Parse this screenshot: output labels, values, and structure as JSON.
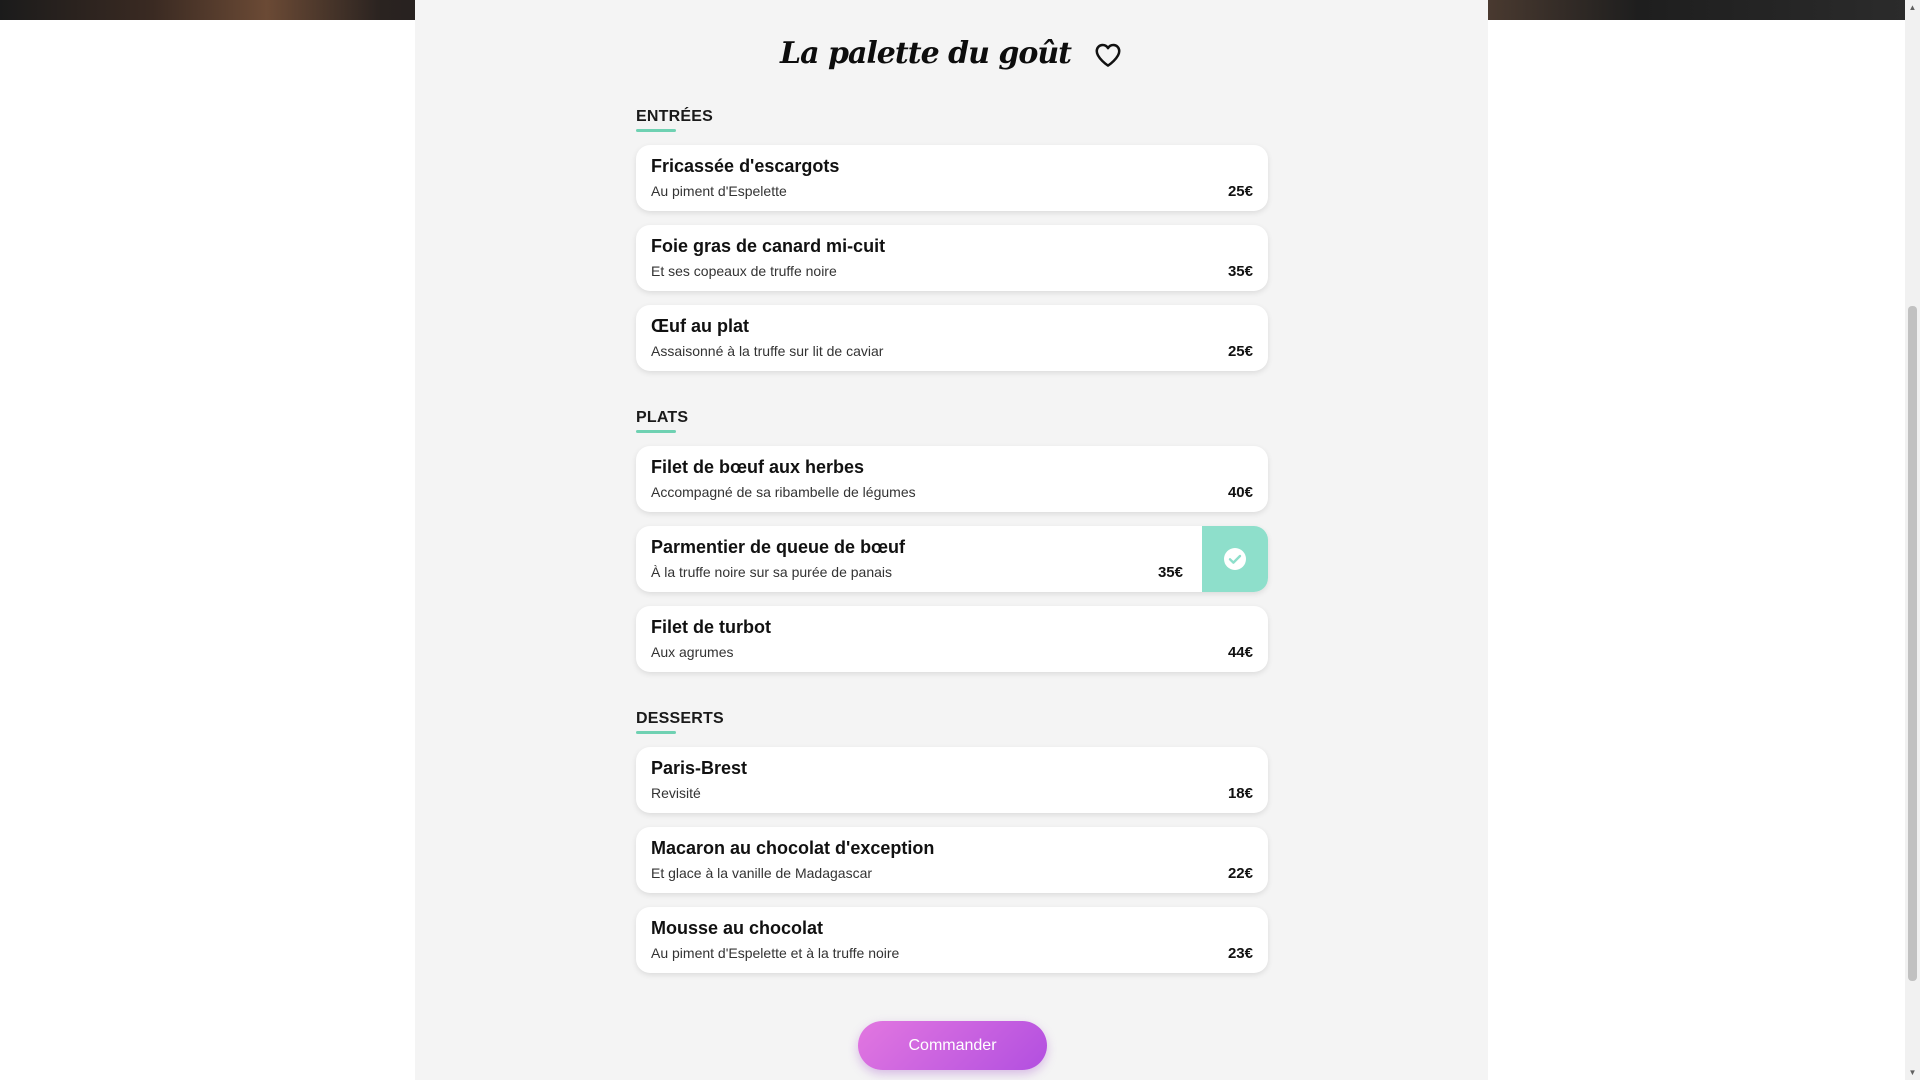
{
  "header": {
    "title": "La palette du goût"
  },
  "sections": [
    {
      "title": "ENTRÉES",
      "items": [
        {
          "name": "Fricassée d'escargots",
          "description": "Au piment d'Espelette",
          "price": "25€"
        },
        {
          "name": "Foie gras de canard mi-cuit",
          "description": "Et ses copeaux de truffe noire",
          "price": "35€"
        },
        {
          "name": "Œuf au plat",
          "description": "Assaisonné à la truffe sur lit de caviar",
          "price": "25€"
        }
      ]
    },
    {
      "title": "PLATS",
      "items": [
        {
          "name": "Filet de bœuf aux herbes",
          "description": "Accompagné de sa ribambelle de légumes",
          "price": "40€"
        },
        {
          "name": "Parmentier de queue de bœuf",
          "description": "À la truffe noire sur sa purée de panais",
          "price": "35€",
          "selected": true
        },
        {
          "name": "Filet de turbot",
          "description": "Aux agrumes",
          "price": "44€"
        }
      ]
    },
    {
      "title": "DESSERTS",
      "items": [
        {
          "name": "Paris-Brest",
          "description": "Revisité",
          "price": "18€"
        },
        {
          "name": "Macaron au chocolat d'exception",
          "description": "Et glace à la vanille de Madagascar",
          "price": "22€"
        },
        {
          "name": "Mousse au chocolat",
          "description": "Au piment d'Espelette et à la truffe noire",
          "price": "23€"
        }
      ]
    }
  ],
  "order_button": {
    "label": "Commander"
  },
  "icons": {
    "favorite": "heart-icon",
    "selected": "check-circle-icon",
    "scroll_up": "triangle-up-icon",
    "scroll_down": "triangle-down-icon"
  },
  "colors": {
    "accent": "#6fd1b2",
    "selected_pane": "#8edfcb",
    "button_start": "#e277e0",
    "button_end": "#b24fe0",
    "card_background": "#f4f4f4"
  }
}
